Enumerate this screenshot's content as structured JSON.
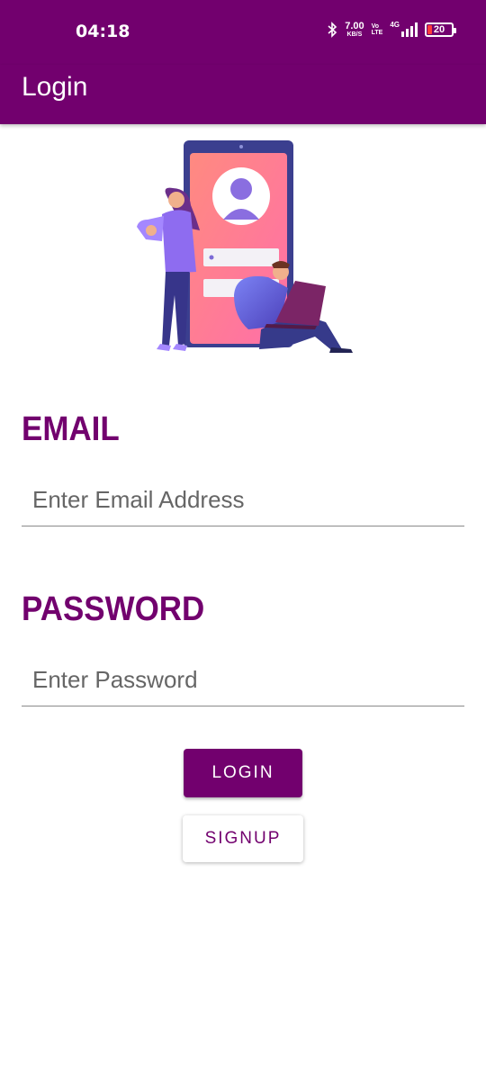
{
  "status_bar": {
    "time": "04:18",
    "speed_value": "7.00",
    "speed_unit": "KB/S",
    "volte_top": "Vo",
    "volte_bottom": "LTE",
    "network": "4G",
    "battery": "20",
    "battery_color": "#ff3b3b"
  },
  "app_bar": {
    "title": "Login",
    "color": "#72006e"
  },
  "form": {
    "email_label": "EMAIL",
    "email_placeholder": "Enter Email Address",
    "email_value": "",
    "password_label": "PASSWORD",
    "password_placeholder": "Enter Password",
    "password_value": ""
  },
  "buttons": {
    "login_label": "LOGIN",
    "signup_label": "SIGNUP"
  },
  "icons": {
    "bluetooth": "bluetooth-icon",
    "signal": "signal-strength-icon",
    "battery": "battery-icon",
    "illustration": "login-illustration"
  }
}
